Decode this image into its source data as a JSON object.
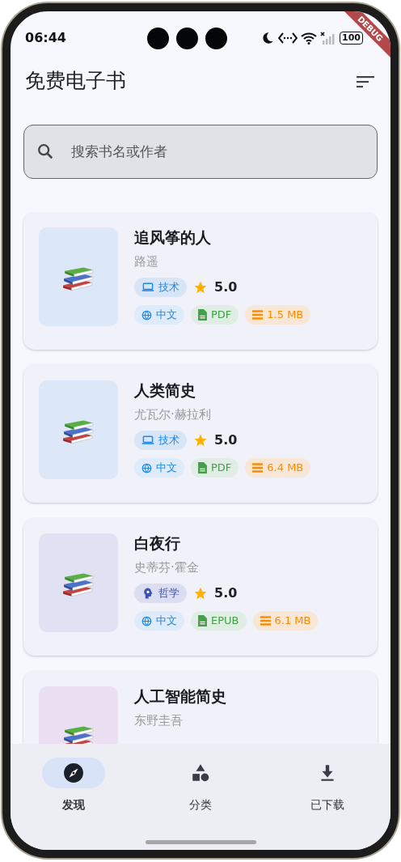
{
  "status_bar": {
    "time": "06:44",
    "battery": "100"
  },
  "debug_ribbon": "DEBUG",
  "app_bar": {
    "title": "免费电子书"
  },
  "search": {
    "placeholder": "搜索书名或作者"
  },
  "books": [
    {
      "title": "追风筝的人",
      "author": "路遥",
      "color": "#dce8f8",
      "category": {
        "label": "技术",
        "kind": "tech",
        "color": "#1e88e5"
      },
      "rating": "5.0",
      "language": "中文",
      "format": "PDF",
      "size": "1.5 MB"
    },
    {
      "title": "人类简史",
      "author": "尤瓦尔·赫拉利",
      "color": "#dce8f8",
      "category": {
        "label": "技术",
        "kind": "tech",
        "color": "#1e88e5"
      },
      "rating": "5.0",
      "language": "中文",
      "format": "PDF",
      "size": "6.4 MB"
    },
    {
      "title": "白夜行",
      "author": "史蒂芬·霍金",
      "color": "#e0e2f3",
      "category": {
        "label": "哲学",
        "kind": "philosophy",
        "color": "#3f51b5"
      },
      "rating": "5.0",
      "language": "中文",
      "format": "EPUB",
      "size": "6.1 MB"
    },
    {
      "title": "人工智能简史",
      "author": "东野圭吾",
      "color": "#ebdff2"
    }
  ],
  "nav": [
    {
      "label": "发现",
      "kind": "discover",
      "selected": true
    },
    {
      "label": "分类",
      "kind": "categories",
      "selected": false
    },
    {
      "label": "已下载",
      "kind": "downloads",
      "selected": false
    }
  ]
}
